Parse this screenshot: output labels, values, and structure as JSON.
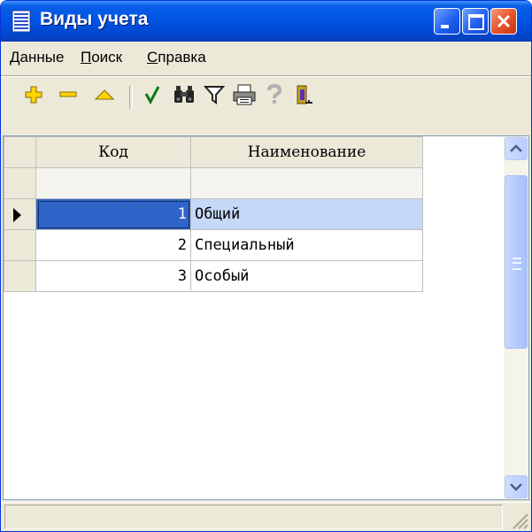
{
  "window": {
    "title": "Виды учета"
  },
  "menu": [
    {
      "label": "Данные"
    },
    {
      "label": "Поиск"
    },
    {
      "label": "Справка"
    }
  ],
  "toolbar": [
    {
      "name": "add-icon"
    },
    {
      "name": "delete-icon"
    },
    {
      "name": "edit-icon"
    },
    {
      "name": "confirm-icon"
    },
    {
      "name": "binoculars-icon"
    },
    {
      "name": "filter-icon"
    },
    {
      "name": "print-icon"
    },
    {
      "name": "help-icon"
    },
    {
      "name": "exit-icon"
    }
  ],
  "grid": {
    "columns": [
      "Код",
      "Наименование"
    ],
    "filter": [
      "",
      ""
    ],
    "rows": [
      {
        "kod": "1",
        "name": "Общий"
      },
      {
        "kod": "2",
        "name": "Специальный"
      },
      {
        "kod": "3",
        "name": "Особый"
      }
    ],
    "selected_row": 1
  },
  "colors": {
    "title_bar": "#0055e5",
    "selection": "#2f64c8",
    "selection_light": "#c6d8f7"
  }
}
